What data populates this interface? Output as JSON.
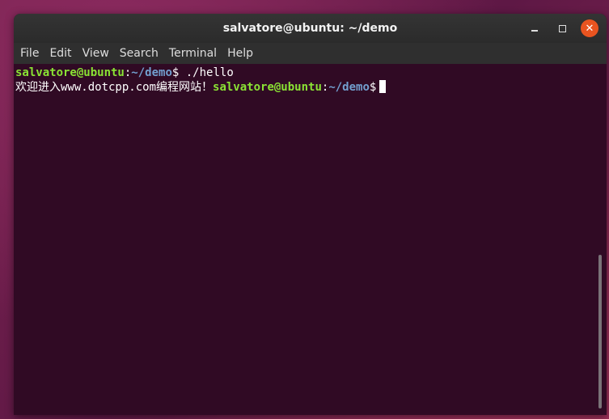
{
  "window": {
    "title": "salvatore@ubuntu: ~/demo"
  },
  "menubar": {
    "items": [
      "File",
      "Edit",
      "View",
      "Search",
      "Terminal",
      "Help"
    ]
  },
  "terminal": {
    "line1": {
      "user_host": "salvatore@ubuntu",
      "colon": ":",
      "path": "~/demo",
      "dollar": "$",
      "command": " ./hello"
    },
    "line2": {
      "output": "欢迎进入www.dotcpp.com编程网站！",
      "user_host": "salvatore@ubuntu",
      "colon": ":",
      "path": "~/demo",
      "dollar": "$"
    }
  },
  "colors": {
    "prompt_user": "#8ae234",
    "prompt_path": "#729fcf",
    "background": "#300a24",
    "close_button": "#e95420"
  }
}
